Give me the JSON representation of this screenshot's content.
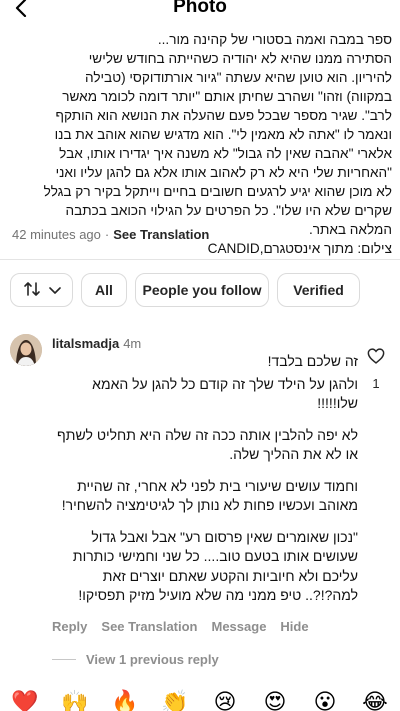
{
  "header": {
    "title": "Photo",
    "back_icon": "chevron-left-icon"
  },
  "caption": {
    "lines": [
      "ספר במבה ואמה בסטורי של קהינה מור... ",
      "הסתירה ממנו שהיא לא יהודיה כשהייתה בחודש שלישי",
      "להיריון. הוא טוען שהיא עשתה \"גיור אורתודוקסי (טבילה",
      "במקווה) וזהו\" ושהרב שחיתן אותם \"יותר דומה לכומר מאשר",
      "לרב\". שגיר מספר שבכל פעם שהעלה את הנושא הוא הותקף",
      "ונאמר לו \"אתה לא מאמין לי\". הוא מדגיש שהוא אוהב את בנו",
      "אלארי \"אהבה שאין לה גבול\" לא משנה איך יגדירו אותו, אבל",
      "\"האחריות שלי היא לא רק לאהוב אותו אלא גם להגן עליו ואני",
      "לא מוכן שהוא יגיע לרגעים חשובים בחיים וייתקל בקיר רק בגלל",
      "שקרים שלא היו שלו\". כל הפרטים על הגילוי הכואב בכתבה",
      "המלאה באתר.",
      "צילום: מתוך אינסטגרם,CANDID"
    ],
    "time": "42 minutes ago",
    "separator": "·",
    "see_translation": "See Translation"
  },
  "filters": {
    "sort_icon": "sort-arrows-icon",
    "chevron_icon": "chevron-down-icon",
    "all": "All",
    "people_you_follow": "People you follow",
    "verified": "Verified"
  },
  "comment": {
    "username": "litalsmadja",
    "time": "4m",
    "like_icon": "heart-outline-icon",
    "like_count": "1",
    "paragraphs": [
      "זה שלכם בלבד!",
      "ולהגן על הילד שלך זה קודם כל להגן על האמא שלו!!!!!",
      "לא יפה להלבין אותה ככה זה שלה היא תחליט לשתף או לא את ההליך שלה.",
      "וחמוד עושים שיעורי בית לפני לא אחרי, זה שהיית מאוהב ועכשיו פחות לא נותן לך לגיטימציה להשחיר!",
      "\"נכון שאומרים שאין פרסום רע\" אבל ואבל גדול שעושים אותו בטעם טוב.... כל שני וחמישי כותרות עליכם ולא חיוביות והקטע שאתם יוצרים זאת למה?!?.. טיפ ממני מה שלא מועיל מזיק תפסיקו!"
    ],
    "actions": {
      "reply": "Reply",
      "see_translation": "See Translation",
      "message": "Message",
      "hide": "Hide"
    }
  },
  "view_previous": "View 1 previous reply",
  "reactions": [
    "❤️",
    "🙌",
    "🔥",
    "👏",
    "😢",
    "😍",
    "😮",
    "😂"
  ]
}
